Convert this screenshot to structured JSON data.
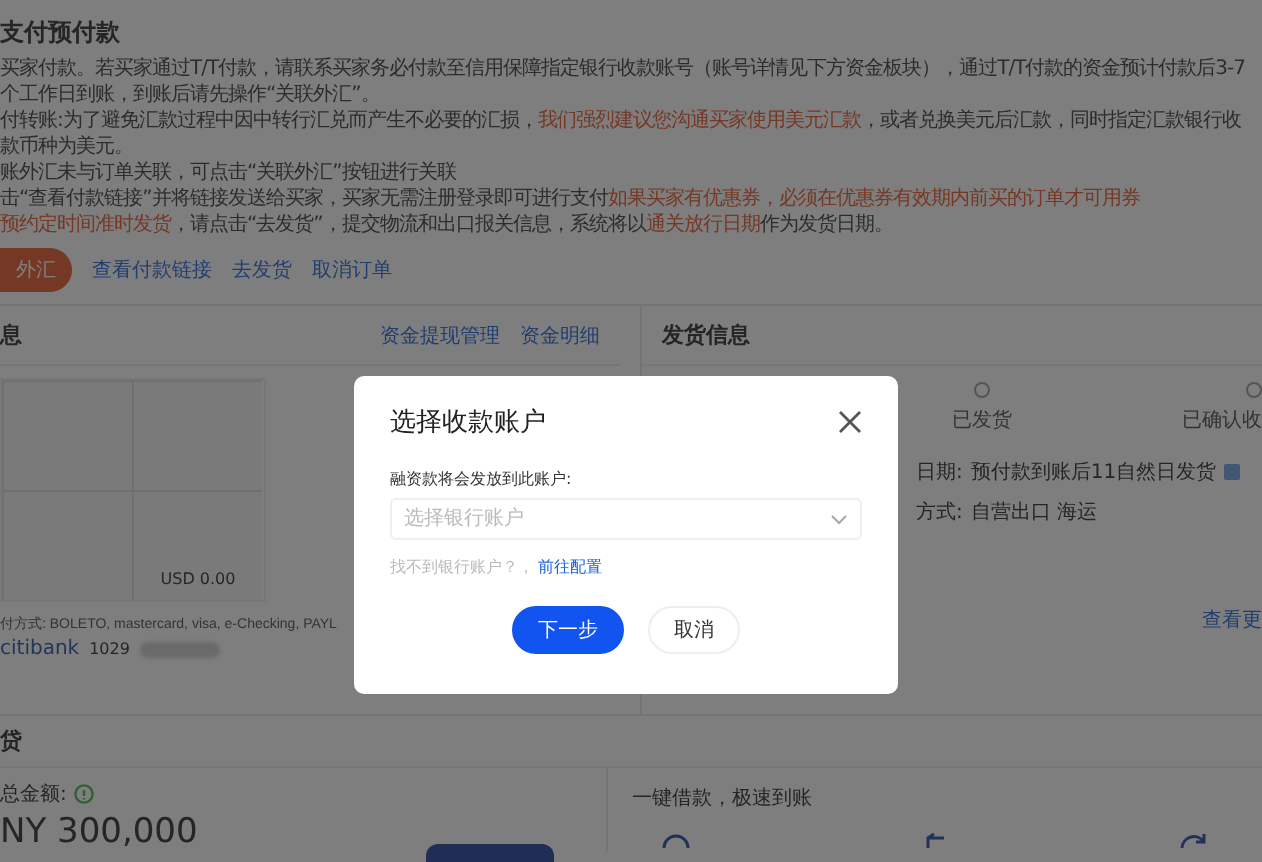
{
  "payment": {
    "title": "支付预付款",
    "notes": [
      [
        {
          "text": "买家付款。若买家通过T/T付款，请联系买家务必付款至信用保障指定银行收款账号（账号详情见下方资金板块），通过T/T付款的资金预计付款后3-7个工作日到账，到账后请先操作“关联外汇”。",
          "highlight": false
        }
      ],
      [
        {
          "text": "付转账:为了避免汇款过程中因中转行汇兑而产生不必要的汇损，",
          "highlight": false
        },
        {
          "text": "我们强烈建议您沟通买家使用美元汇款",
          "highlight": true
        },
        {
          "text": "，或者兑换美元后汇款，同时指定汇款银行收款币种为美元。",
          "highlight": false
        }
      ],
      [
        {
          "text": "账外汇未与订单关联，可点击“关联外汇”按钮进行关联",
          "highlight": false
        }
      ],
      [
        {
          "text": "击“查看付款链接”并将链接发送给买家，买家无需注册登录即可进行支付",
          "highlight": false
        },
        {
          "text": "如果买家有优惠券，必须在优惠券有效期内前买的订单才可用券",
          "highlight": true
        }
      ],
      [
        {
          "text": "预约定时间准时发货",
          "highlight": true
        },
        {
          "text": "，请点击“去发货”，提交物流和出口报关信息，系统将以",
          "highlight": false
        },
        {
          "text": "通关放行日期",
          "highlight": true
        },
        {
          "text": "作为发货日期。",
          "highlight": false
        }
      ]
    ],
    "primary_action": "外汇",
    "links": [
      "查看付款链接",
      "去发货",
      "取消订单"
    ]
  },
  "funds": {
    "title": "息",
    "links": [
      "资金提现管理",
      "资金明细"
    ],
    "amount": "USD 0.00",
    "methods": "付方式: BOLETO, mastercard, visa, e-Checking, PAYL",
    "bank": "citibank",
    "account": "1029"
  },
  "shipping": {
    "title": "发货信息",
    "steps": [
      "已发货",
      "已确认收"
    ],
    "date_label": "日期:",
    "date_value": "预付款到账后11自然日发货",
    "mode_label": "方式:",
    "mode_value": "自营出口 海运",
    "more": "查看更"
  },
  "loan": {
    "title": "贷",
    "total_label": "总金额:",
    "total": "NY 300,000",
    "promo": "一键借款，极速到账"
  },
  "modal": {
    "title": "选择收款账户",
    "field_label": "融资款将会发放到此账户:",
    "placeholder": "选择银行账户",
    "hint": "找不到银行账户？，",
    "hint_link": "前往配置",
    "buttons": [
      {
        "label": "下一步",
        "kind": "primary"
      },
      {
        "label": "取消",
        "kind": "secondary"
      }
    ]
  }
}
